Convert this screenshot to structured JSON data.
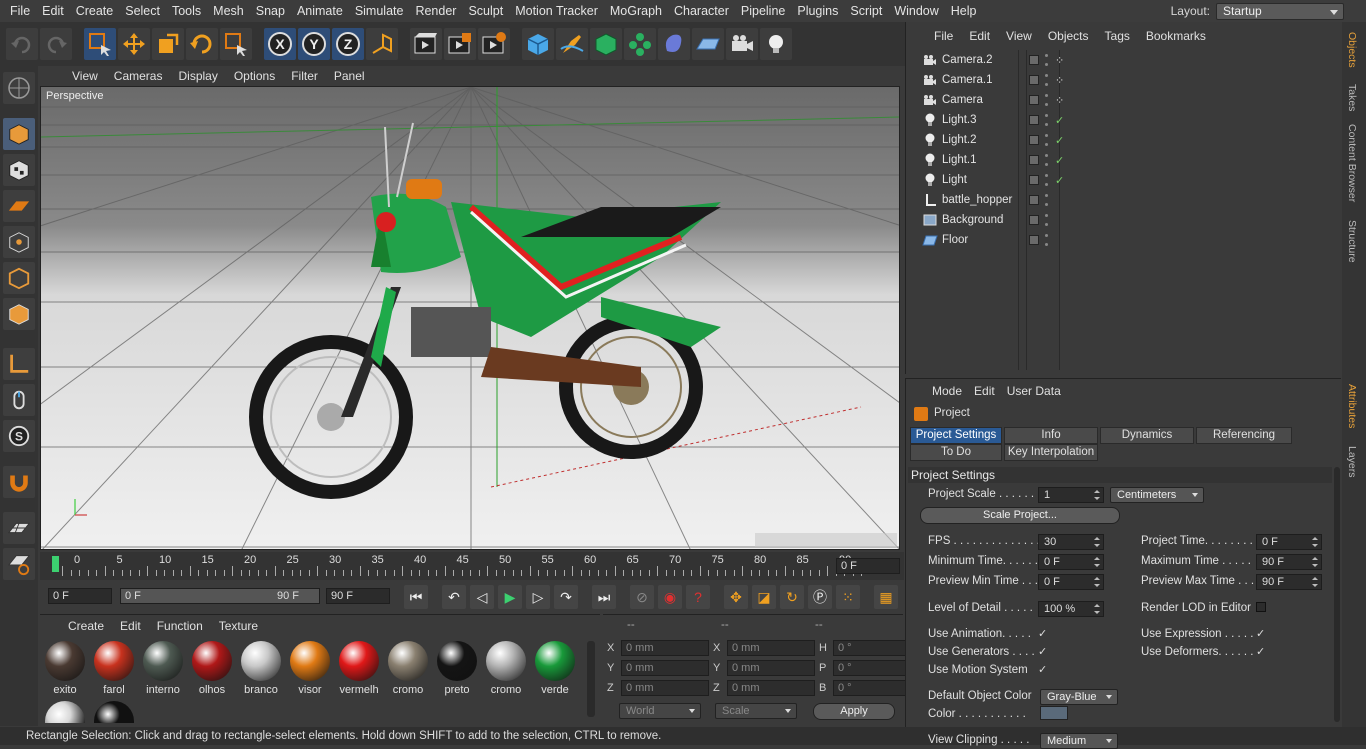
{
  "menubar": {
    "items": [
      "File",
      "Edit",
      "Create",
      "Select",
      "Tools",
      "Mesh",
      "Snap",
      "Animate",
      "Simulate",
      "Render",
      "Sculpt",
      "Motion Tracker",
      "MoGraph",
      "Character",
      "Pipeline",
      "Plugins",
      "Script",
      "Window",
      "Help"
    ],
    "layout_label": "Layout:",
    "layout_value": "Startup"
  },
  "toolbar": {
    "icons": [
      "undo-icon",
      "redo-icon",
      "live-selection-icon",
      "move-icon",
      "scale-icon",
      "rotate-icon",
      "last-tool-icon",
      "x-axis-icon",
      "y-axis-icon",
      "z-axis-icon",
      "coordinate-system-icon",
      "render-view-icon",
      "render-picture-viewer-icon",
      "render-settings-icon",
      "cube-icon",
      "pen-icon",
      "subdivision-icon",
      "cloner-icon",
      "deformer-icon",
      "floor-icon",
      "camera-icon",
      "light-icon"
    ],
    "axis": {
      "x": "X",
      "y": "Y",
      "z": "Z"
    }
  },
  "viewport": {
    "menu": [
      "View",
      "Cameras",
      "Display",
      "Options",
      "Filter",
      "Panel"
    ],
    "label": "Perspective"
  },
  "timeline": {
    "ticks": [
      "0",
      "5",
      "10",
      "15",
      "20",
      "25",
      "30",
      "35",
      "40",
      "45",
      "50",
      "55",
      "60",
      "65",
      "70",
      "75",
      "80",
      "85",
      "90"
    ],
    "current": "0 F",
    "start": "0 F",
    "range_start": "0 F",
    "range_end": "90 F",
    "end": "90 F"
  },
  "materials": {
    "menu": [
      "Create",
      "Edit",
      "Function",
      "Texture"
    ],
    "items": [
      {
        "name": "exito",
        "color": "#4a3a32"
      },
      {
        "name": "farol",
        "color": "#c8321e"
      },
      {
        "name": "interno",
        "color": "#4e5a52"
      },
      {
        "name": "olhos",
        "color": "#b01818"
      },
      {
        "name": "branco",
        "color": "#c8c8c8"
      },
      {
        "name": "visor",
        "color": "#e07a14"
      },
      {
        "name": "vermelh",
        "color": "#e01818"
      },
      {
        "name": "cromo",
        "color": "#8a8070"
      },
      {
        "name": "preto",
        "color": "#141414"
      },
      {
        "name": "cromo",
        "color": "#b4b4b4"
      },
      {
        "name": "verde",
        "color": "#189a3a"
      }
    ]
  },
  "coords": {
    "headers": [
      "--",
      "--",
      "--"
    ],
    "rows": [
      {
        "a": "X",
        "av": "0 mm",
        "b": "X",
        "bv": "0 mm",
        "c": "H",
        "cv": "0 °"
      },
      {
        "a": "Y",
        "av": "0 mm",
        "b": "Y",
        "bv": "0 mm",
        "c": "P",
        "cv": "0 °"
      },
      {
        "a": "Z",
        "av": "0 mm",
        "b": "Z",
        "bv": "0 mm",
        "c": "B",
        "cv": "0 °"
      }
    ],
    "world": "World",
    "scale": "Scale",
    "apply": "Apply"
  },
  "status": "Rectangle Selection: Click and drag to rectangle-select elements. Hold down SHIFT to add to the selection, CTRL to remove.",
  "objects": {
    "menu": [
      "File",
      "Edit",
      "View",
      "Objects",
      "Tags",
      "Bookmarks"
    ],
    "items": [
      {
        "name": "Camera.2",
        "icon": "camera-icon",
        "tag": "dots"
      },
      {
        "name": "Camera.1",
        "icon": "camera-icon",
        "tag": "dots"
      },
      {
        "name": "Camera",
        "icon": "camera-icon",
        "tag": "dots"
      },
      {
        "name": "Light.3",
        "icon": "light-icon",
        "tag": "check"
      },
      {
        "name": "Light.2",
        "icon": "light-icon",
        "tag": "check"
      },
      {
        "name": "Light.1",
        "icon": "light-icon",
        "tag": "check"
      },
      {
        "name": "Light",
        "icon": "light-icon",
        "tag": "check"
      },
      {
        "name": "battle_hopper",
        "icon": "null-icon",
        "tag": ""
      },
      {
        "name": "Background",
        "icon": "background-icon",
        "tag": ""
      },
      {
        "name": "Floor",
        "icon": "floor-icon",
        "tag": ""
      }
    ]
  },
  "side_tabs": {
    "right_top": [
      "Objects",
      "Takes",
      "Content Browser",
      "Structure"
    ],
    "right_bottom": [
      "Attributes",
      "Layers"
    ]
  },
  "attributes": {
    "menu": [
      "Mode",
      "Edit",
      "User Data"
    ],
    "title": "Project",
    "tabs": [
      "Project Settings",
      "Info",
      "Dynamics",
      "Referencing",
      "To Do",
      "Key Interpolation"
    ],
    "section": "Project Settings",
    "project_scale_label": "Project Scale . . . . . .",
    "project_scale": "1",
    "project_scale_unit": "Centimeters",
    "scale_project_btn": "Scale Project...",
    "fps_label": "FPS . . . . . . . . . . . . . .",
    "fps": "30",
    "project_time_label": "Project Time. . . . . . . .",
    "project_time": "0 F",
    "min_time_label": "Minimum Time. . . . . . .",
    "min_time": "0 F",
    "max_time_label": "Maximum Time . . . . .",
    "max_time": "90 F",
    "prev_min_label": "Preview Min Time . . .",
    "prev_min": "0 F",
    "prev_max_label": "Preview Max Time . . .",
    "prev_max": "90 F",
    "lod_label": "Level of Detail . . . . .",
    "lod": "100 %",
    "render_lod_label": "Render LOD in Editor",
    "use_anim_label": "Use Animation. . . . .",
    "use_expr_label": "Use Expression . . . . .",
    "use_gen_label": "Use Generators . . . .",
    "use_def_label": "Use Deformers. . . . . .",
    "use_motion_label": "Use Motion System",
    "check": "✓",
    "def_color_label": "Default Object Color",
    "def_color": "Gray-Blue",
    "color_label": "Color . . . . . . . . . . .",
    "view_clip_label": "View Clipping . . . . .",
    "view_clip": "Medium"
  }
}
